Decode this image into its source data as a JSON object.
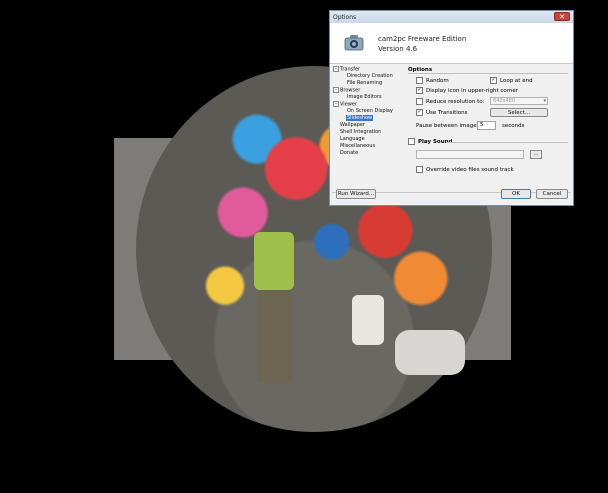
{
  "dialog": {
    "title": "Options",
    "close_glyph": "✕",
    "app_name": "cam2pc Freeware Edition",
    "app_version": "Version 4.6",
    "app_icon": "camera-icon"
  },
  "tree": [
    {
      "label": "Transfer",
      "level": 0,
      "expander": "⊟"
    },
    {
      "label": "Directory Creation",
      "level": 1
    },
    {
      "label": "File Renaming",
      "level": 1
    },
    {
      "label": "Browser",
      "level": 0,
      "expander": "⊟"
    },
    {
      "label": "Image Editors",
      "level": 1
    },
    {
      "label": "Viewer",
      "level": 0,
      "expander": "⊟"
    },
    {
      "label": "On Screen Display",
      "level": 1
    },
    {
      "label": "Slideshow",
      "level": 1,
      "selected": true
    },
    {
      "label": "Wallpaper",
      "level": 0
    },
    {
      "label": "Shell Integration",
      "level": 0
    },
    {
      "label": "Language",
      "level": 0
    },
    {
      "label": "Miscellaneous",
      "level": 0
    },
    {
      "label": "Donate",
      "level": 0
    }
  ],
  "options": {
    "section_label": "Options",
    "random": {
      "label": "Random",
      "checked": false
    },
    "loop_at_end": {
      "label": "Loop at end",
      "checked": true
    },
    "display_icon": {
      "label": "Display icon in upper-right corner",
      "checked": true
    },
    "reduce_resolution": {
      "label": "Reduce resolution to:",
      "checked": false
    },
    "resolution_value": "640x480",
    "use_transitions": {
      "label": "Use Transitions",
      "checked": true
    },
    "select_button": "Select...",
    "pause_label": "Pause between images",
    "pause_value": "5",
    "pause_unit": "seconds"
  },
  "sound": {
    "play_sound": {
      "label": "Play Sound",
      "checked": false
    },
    "browse_glyph": "…",
    "override": {
      "label": "Override video files sound track",
      "checked": false
    }
  },
  "buttons": {
    "run_wizard": "Run Wizard...",
    "ok": "OK",
    "cancel": "Cancel"
  }
}
